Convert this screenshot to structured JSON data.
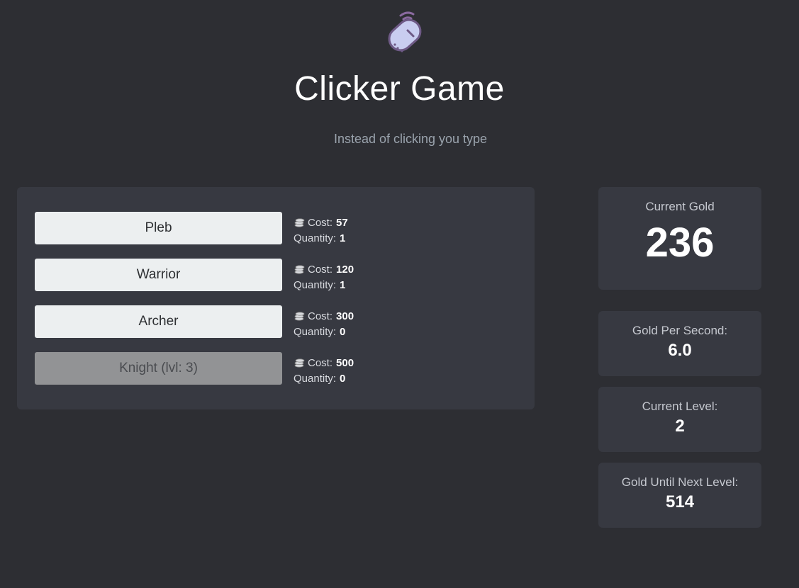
{
  "header": {
    "logo_icon": "mouse-icon",
    "title": "Clicker Game",
    "subtitle": "Instead of clicking you type"
  },
  "units": [
    {
      "name": "Pleb",
      "cost_label": "Cost:",
      "cost": "57",
      "quantity_label": "Quantity:",
      "quantity": "1",
      "enabled": true
    },
    {
      "name": "Warrior",
      "cost_label": "Cost:",
      "cost": "120",
      "quantity_label": "Quantity:",
      "quantity": "1",
      "enabled": true
    },
    {
      "name": "Archer",
      "cost_label": "Cost:",
      "cost": "300",
      "quantity_label": "Quantity:",
      "quantity": "0",
      "enabled": true
    },
    {
      "name": "Knight (lvl: 3)",
      "cost_label": "Cost:",
      "cost": "500",
      "quantity_label": "Quantity:",
      "quantity": "0",
      "enabled": false
    }
  ],
  "stats": {
    "current_gold": {
      "label": "Current Gold",
      "value": "236"
    },
    "gold_per_second": {
      "label": "Gold Per Second:",
      "value": "6.0"
    },
    "current_level": {
      "label": "Current Level:",
      "value": "2"
    },
    "gold_until_next_level": {
      "label": "Gold Until Next Level:",
      "value": "514"
    }
  },
  "colors": {
    "background": "#2d2e33",
    "panel": "#373941",
    "button": "#eceff0",
    "button_disabled": "#929395",
    "logo_fill": "#c9cdf0",
    "logo_stroke": "#8a6aa0"
  }
}
